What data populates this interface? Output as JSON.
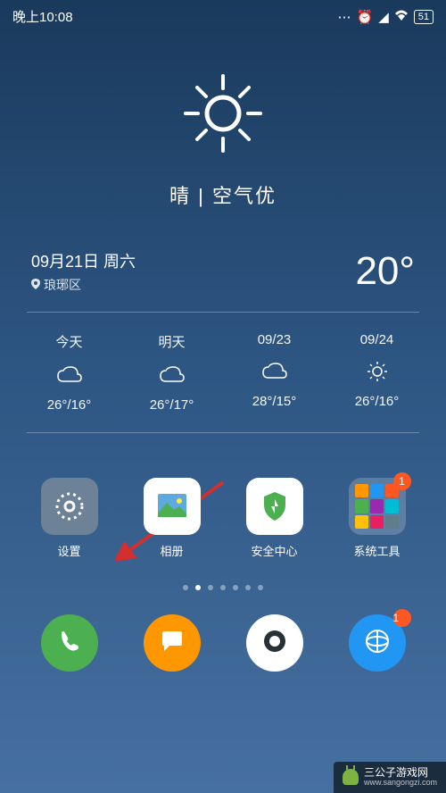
{
  "status": {
    "time": "晚上10:08",
    "battery": "51"
  },
  "weather": {
    "condition": "晴 | 空气优",
    "date": "09月21日 周六",
    "location": "琅琊区",
    "temp_now": "20°"
  },
  "forecast": [
    {
      "label": "今天",
      "icon": "cloud",
      "temp": "26°/16°"
    },
    {
      "label": "明天",
      "icon": "cloud",
      "temp": "26°/17°"
    },
    {
      "label": "09/23",
      "icon": "cloud",
      "temp": "28°/15°"
    },
    {
      "label": "09/24",
      "icon": "sun",
      "temp": "26°/16°"
    }
  ],
  "apps": [
    {
      "name": "settings",
      "label": "设置",
      "badge": null
    },
    {
      "name": "gallery",
      "label": "相册",
      "badge": null
    },
    {
      "name": "security",
      "label": "安全中心",
      "badge": null
    },
    {
      "name": "system-tools",
      "label": "系统工具",
      "badge": "1"
    }
  ],
  "dock": [
    {
      "name": "phone",
      "badge": null
    },
    {
      "name": "messages",
      "badge": null
    },
    {
      "name": "camera",
      "badge": null
    },
    {
      "name": "browser",
      "badge": "1"
    }
  ],
  "pagination": {
    "total": 7,
    "active": 1
  },
  "watermark": {
    "title": "三公子游戏网",
    "url": "www.sangongzi.com"
  },
  "colors": {
    "settings_bg": "#6d8296",
    "gallery_bg": "#ffffff",
    "security_bg": "#ffffff",
    "folder_bg": "rgba(255,255,255,0.2)",
    "phone_bg": "#4caf50",
    "messages_bg": "#ff9800",
    "camera_bg": "#ffffff",
    "browser_bg": "#2196f3"
  }
}
